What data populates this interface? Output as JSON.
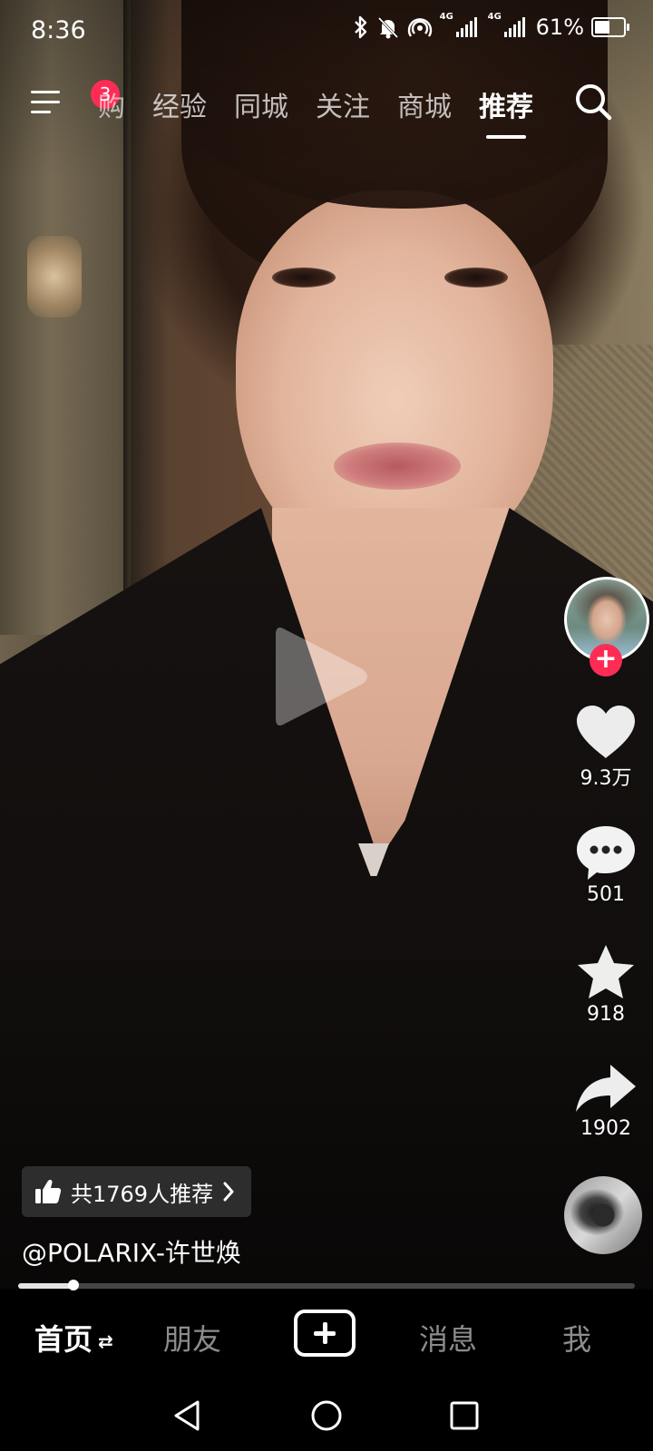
{
  "status_bar": {
    "time": "8:36",
    "network1": "4G",
    "network2": "4G",
    "battery_percent": "61%",
    "battery_level": 0.61,
    "icons": [
      "bluetooth-icon",
      "bell-off-icon",
      "hotspot-icon",
      "signal-icon",
      "signal-icon",
      "battery-icon"
    ]
  },
  "top_nav": {
    "menu_badge": "3",
    "tabs": [
      {
        "label": "购",
        "active": false
      },
      {
        "label": "经验",
        "active": false
      },
      {
        "label": "同城",
        "active": false
      },
      {
        "label": "关注",
        "active": false
      },
      {
        "label": "商城",
        "active": false
      },
      {
        "label": "推荐",
        "active": true
      }
    ]
  },
  "right_rail": {
    "follow_symbol": "+",
    "likes": "9.3万",
    "comments": "501",
    "favorites": "918",
    "shares": "1902"
  },
  "video_info": {
    "recommend_text": "共1769人推荐",
    "author": "@POLARIX-许世焕",
    "progress": 0.09
  },
  "bottom_nav": {
    "home": "首页",
    "friends": "朋友",
    "messages": "消息",
    "me": "我"
  },
  "colors": {
    "accent": "#fe2c55",
    "background": "#000000",
    "text": "#ffffff"
  }
}
